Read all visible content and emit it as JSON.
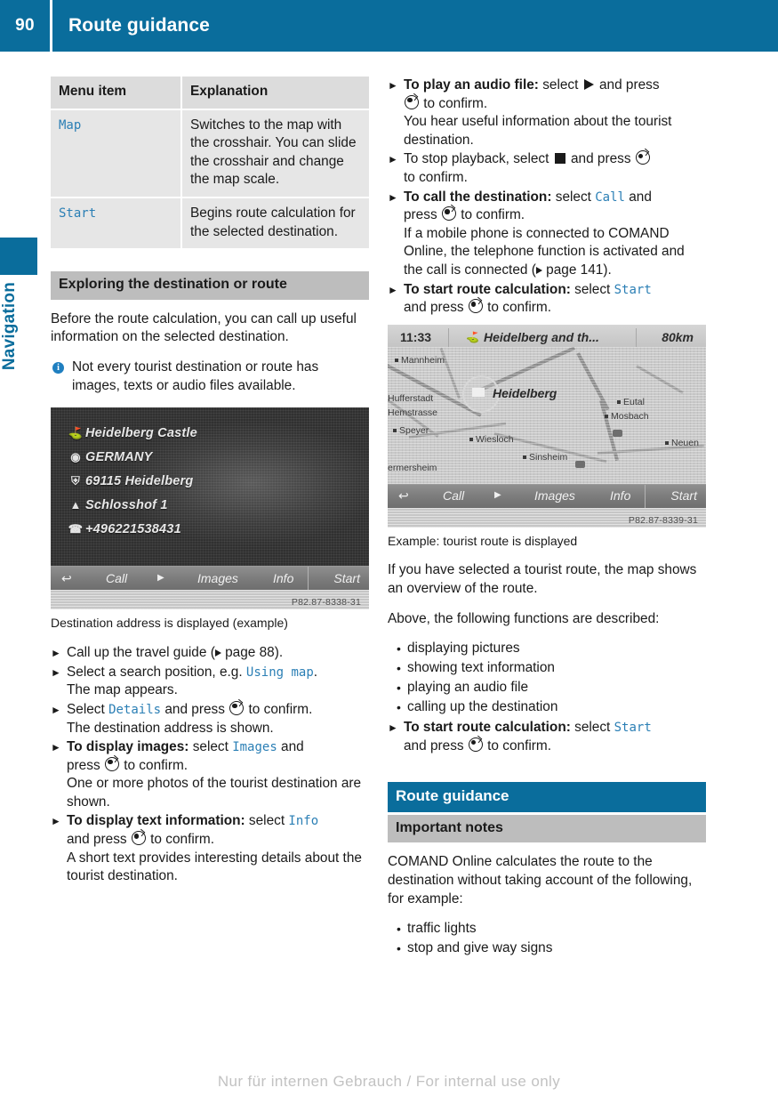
{
  "header": {
    "page_number": "90",
    "title": "Route guidance"
  },
  "side_tab": {
    "label": "Navigation"
  },
  "colors": {
    "brand_blue": "#0a6d9c",
    "command_text_blue": "#2b7fb5",
    "heading_gray": "#bdbdbd",
    "table_header_gray": "#dcdcdc",
    "table_cell_gray": "#e6e6e6"
  },
  "left_column": {
    "table": {
      "headers": [
        "Menu item",
        "Explanation"
      ],
      "rows": [
        {
          "menu_item": "Map",
          "explanation": "Switches to the map with the crosshair. You can slide the crosshair and change the map scale."
        },
        {
          "menu_item": "Start",
          "explanation": "Begins route calculation for the selected destination."
        }
      ]
    },
    "section_heading": "Exploring the destination or route",
    "intro_paragraph": "Before the route calculation, you can call up useful information on the selected destination.",
    "note": {
      "icon": "info-icon",
      "text": "Not every tourist destination or route has images, texts or audio files available."
    },
    "figure1": {
      "caption": "Destination address is displayed (example)",
      "watermark_code": "P82.87-8338-31",
      "address_lines": [
        {
          "icon": "castle-icon",
          "text": "Heidelberg Castle"
        },
        {
          "icon": "globe-icon",
          "text": "GERMANY"
        },
        {
          "icon": "city-icon",
          "text": "69115 Heidelberg"
        },
        {
          "icon": "street-icon",
          "text": "Schlosshof 1"
        },
        {
          "icon": "phone-icon",
          "text": "+496221538431"
        }
      ],
      "toolbar": {
        "back": "↩",
        "call": "Call",
        "play": "▶",
        "images": "Images",
        "info": "Info",
        "start": "Start"
      }
    },
    "steps": [
      {
        "bold": "",
        "text": "Call up the travel guide (",
        "page_ref": "page 88",
        "text_after": ").",
        "sub": []
      },
      {
        "bold": "",
        "text": "Select a search position, e.g. ",
        "command": "Using map",
        "text_after": ".",
        "sub": [
          "The map appears."
        ]
      },
      {
        "bold": "",
        "text": "Select ",
        "command": "Details",
        "text_after": " and press ⓢ to confirm.",
        "sub": [
          "The destination address is shown."
        ]
      },
      {
        "bold": "To display images:",
        "text": " select ",
        "command": "Images",
        "text_after": " and press ⓢ to confirm.",
        "sub": [
          "One or more photos of the tourist destination are shown."
        ]
      },
      {
        "bold": "To display text information:",
        "text": " select ",
        "command": "Info",
        "text_after": " and press ⓢ to confirm.",
        "sub": [
          "A short text provides interesting details about the tourist destination."
        ]
      }
    ],
    "step1_prefix": "Call up the travel guide (",
    "step1_pageref": "page 88",
    "step1_suffix": ").",
    "step2_prefix": "Select a search position, e.g. ",
    "step2_cmd": "Using map",
    "step2_suffix": ".",
    "step2_sub": "The map appears.",
    "step3_prefix": "Select ",
    "step3_cmd": "Details",
    "step3_mid": " and press ",
    "step3_suffix": " to confirm.",
    "step3_sub": "The destination address is shown.",
    "step4_bold": "To display images:",
    "step4_prefix": " select ",
    "step4_cmd": "Images",
    "step4_mid": " and",
    "step4_line2a": "press ",
    "step4_line2b": " to confirm.",
    "step4_sub": "One or more photos of the tourist destination are shown.",
    "step5_bold": "To display text information:",
    "step5_prefix": " select ",
    "step5_cmd": "Info",
    "step5_line2a": "and press ",
    "step5_line2b": " to confirm.",
    "step5_sub": "A short text provides interesting details about the tourist destination."
  },
  "right_column": {
    "step1_bold": "To play an audio file:",
    "step1_prefix": " select ",
    "step1_mid": " and press",
    "step1_line2": " to confirm.",
    "step1_sub": "You hear useful information about the tourist destination.",
    "step2_prefix": "To stop playback, select ",
    "step2_mid": " and press ",
    "step2_line2": "to confirm.",
    "step3_bold": "To call the destination:",
    "step3_prefix": " select ",
    "step3_cmd": "Call",
    "step3_mid": " and",
    "step3_line2a": "press ",
    "step3_line2b": " to confirm.",
    "step3_sub_a": "If a mobile phone is connected to COMAND Online, the telephone function is activated and the call is connected (",
    "step3_pageref": "page 141",
    "step3_sub_b": ").",
    "step4_bold": "To start route calculation:",
    "step4_prefix": " select ",
    "step4_cmd": "Start",
    "step4_line2a": "and press ",
    "step4_line2b": " to confirm.",
    "figure2": {
      "caption": "Example: tourist route is displayed",
      "watermark_code": "P82.87-8339-31",
      "status_bar": {
        "time": "11:33",
        "route_name": "Heidelberg and th...",
        "distance": "80km"
      },
      "map_labels": [
        "Mannheim",
        "Hufferstadt",
        "Hemstrasse",
        "Speyer",
        "Wiesloch",
        "Sinsheim",
        "ermersheim",
        "Eutal",
        "Mosbach",
        "Neuen"
      ],
      "highlight_city": "Heidelberg",
      "toolbar": {
        "back": "↩",
        "call": "Call",
        "play": "▶",
        "images": "Images",
        "info": "Info",
        "start": "Start"
      }
    },
    "para1": "If you have selected a tourist route, the map shows an overview of the route.",
    "para2": "Above, the following functions are described:",
    "bullets": [
      "displaying pictures",
      "showing text information",
      "playing an audio file",
      "calling up the destination"
    ],
    "step5_bold": "To start route calculation:",
    "step5_prefix": " select ",
    "step5_cmd": "Start",
    "step5_line2a": "and press ",
    "step5_line2b": " to confirm.",
    "section_heading_blue": "Route guidance",
    "section_heading_gray": "Important notes",
    "notes_para": "COMAND Online calculates the route to the destination without taking account of the following, for example:",
    "notes_bullets": [
      "traffic lights",
      "stop and give way signs"
    ]
  },
  "footer": {
    "watermark": "Nur für internen Gebrauch / For internal use only"
  }
}
